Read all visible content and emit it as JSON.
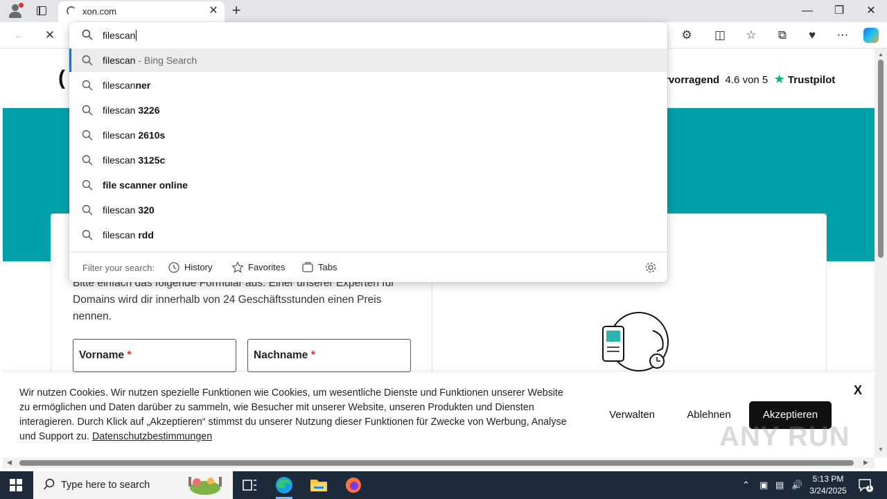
{
  "browser": {
    "tab_title": "xon.com",
    "tab_close": "✕",
    "new_tab": "+",
    "window_controls": {
      "minimize": "—",
      "maximize": "❐",
      "close": "✕"
    }
  },
  "omnibox": {
    "input_value": "filescan",
    "suggestions": [
      {
        "typed": "filescan",
        "bold": "",
        "suffix": " - Bing Search"
      },
      {
        "typed": "filescan",
        "bold": "ner",
        "suffix": ""
      },
      {
        "typed": "filescan ",
        "bold": "3226",
        "suffix": ""
      },
      {
        "typed": "filescan ",
        "bold": "2610s",
        "suffix": ""
      },
      {
        "typed": "filescan ",
        "bold": "3125c",
        "suffix": ""
      },
      {
        "typed": "",
        "bold": "file scanner online",
        "suffix": ""
      },
      {
        "typed": "filescan ",
        "bold": "320",
        "suffix": ""
      },
      {
        "typed": "filescan ",
        "bold": "rdd",
        "suffix": ""
      }
    ],
    "filter_label": "Filter your search:",
    "filters": {
      "history": "History",
      "favorites": "Favorites",
      "tabs": "Tabs"
    }
  },
  "site": {
    "logo_partial": "(",
    "rating_word": "rvorragend",
    "rating_score": "4.6 von 5",
    "trustpilot": "Trustpilot",
    "intro_text": "Bitte einfach das folgende Formular aus. Einer unserer Experten für Domains wird dir innerhalb von 24 Geschäftsstunden einen Preis nennen.",
    "first_name_label": "Vorname",
    "last_name_label": "Nachname",
    "required_mark": "*"
  },
  "cookie_banner": {
    "text": "Wir nutzen Cookies. Wir nutzen spezielle Funktionen wie Cookies, um wesentliche Dienste und Funktionen unserer Website zu ermöglichen und Daten darüber zu sammeln, wie Besucher mit unserer Website, unseren Produkten und Diensten interagieren. Durch Klick auf „Akzeptieren“ stimmst du unserer Nutzung dieser Funktionen für Zwecke von Werbung, Analyse und Support zu.",
    "privacy_link": "Datenschutzbestimmungen",
    "manage": "Verwalten",
    "reject": "Ablehnen",
    "accept": "Akzeptieren",
    "close": "X"
  },
  "watermark": "ANY RUN",
  "taskbar": {
    "search_placeholder": "Type here to search",
    "time": "5:13 PM",
    "date": "3/24/2025",
    "notification_count": "1"
  },
  "colors": {
    "teal": "#00a0a8",
    "trustpilot_green": "#00b67a",
    "selection_accent": "#2f6bb5",
    "taskbar": "#1c2a3a"
  }
}
